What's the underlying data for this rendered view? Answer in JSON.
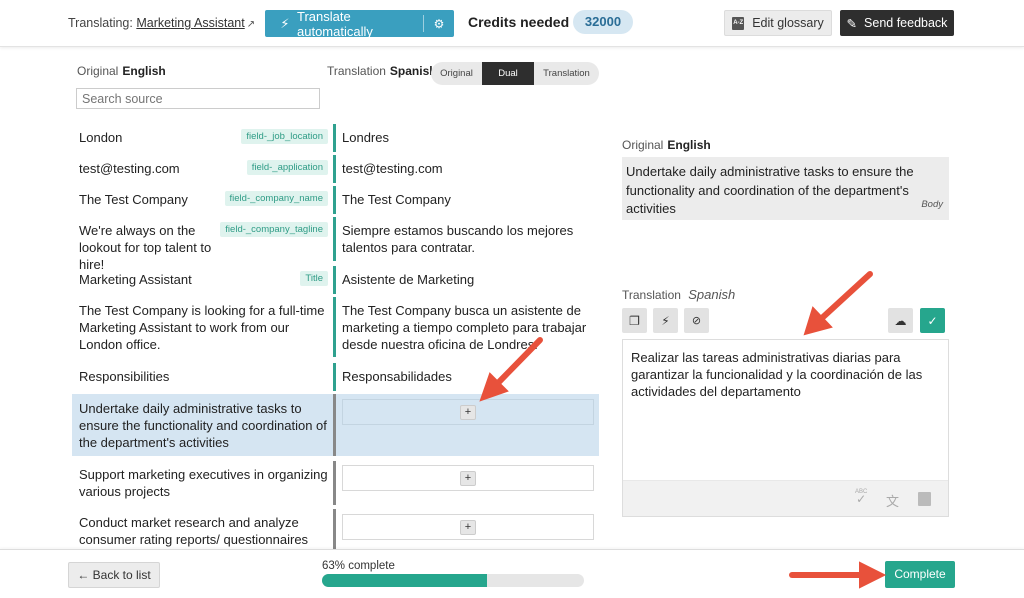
{
  "header": {
    "translating_label": "Translating:",
    "job_name": "Marketing Assistant",
    "translate_button": "Translate automatically",
    "credits_label": "Credits needed",
    "credits_value": "32000",
    "glossary_button": "Edit glossary",
    "glossary_icon_text": "A-Z",
    "feedback_button": "Send feedback"
  },
  "columns": {
    "original_label": "Original",
    "original_lang": "English",
    "translation_label": "Translation",
    "translation_lang": "Spanish",
    "search_placeholder": "Search source",
    "view_toggle": [
      "Original",
      "Dual",
      "Translation"
    ],
    "view_selected": "Dual"
  },
  "rows": [
    {
      "source": "London",
      "tag": "field-_job_location",
      "translation": "Londres"
    },
    {
      "source": "test@testing.com",
      "tag": "field-_application",
      "translation": "test@testing.com"
    },
    {
      "source": "The Test Company",
      "tag": "field-_company_name",
      "translation": "The Test Company"
    },
    {
      "source": "We're always on the lookout for top talent to hire!",
      "tag": "field-_company_tagline",
      "translation": "Siempre estamos buscando los mejores talentos para contratar."
    },
    {
      "source": "Marketing Assistant",
      "tag": "Title",
      "translation": "Asistente de Marketing"
    },
    {
      "source": "The Test Company is looking for a full-time Marketing Assistant to work from our London office.",
      "tag": "",
      "translation": "The Test Company busca un asistente de marketing a tiempo completo para trabajar desde nuestra oficina de Londres."
    },
    {
      "source": "Responsibilities",
      "tag": "",
      "translation": "Responsabilidades"
    },
    {
      "source": "Undertake daily administrative tasks to ensure the functionality and coordination of the department's activities",
      "tag": "",
      "translation": "",
      "add_label": "+"
    },
    {
      "source": "Support marketing executives in organizing various projects",
      "tag": "",
      "translation": "",
      "add_label": "+"
    },
    {
      "source": "Conduct market research and analyze consumer rating reports/ questionnaires",
      "tag": "",
      "translation": "",
      "add_label": "+"
    }
  ],
  "panel": {
    "original_label": "Original",
    "original_lang": "English",
    "original_text": "Undertake daily administrative tasks to ensure the functionality and coordination of the department's activities",
    "segment_type": "Body",
    "translation_label": "Translation",
    "translation_lang": "Spanish",
    "translation_text": "Realizar las tareas administrativas diarias para garantizar la funcionalidad y la coordinación de las actividades del departamento",
    "abc_label": "ABC"
  },
  "footer": {
    "back_button": "← Back to list",
    "progress_label": "63% complete",
    "progress_percent": 63,
    "complete_button": "Complete"
  },
  "colors": {
    "accent_blue": "#3a9fbf",
    "accent_green": "#26a68d",
    "arrow_red": "#e8513b",
    "active_row": "#d5e5f2"
  }
}
